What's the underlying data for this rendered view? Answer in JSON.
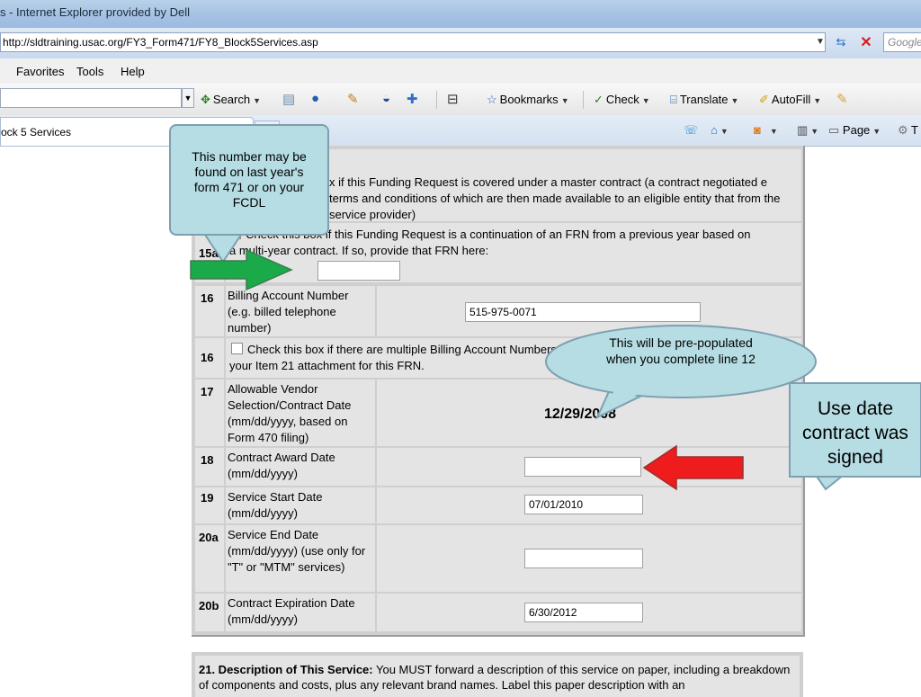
{
  "window": {
    "title": "s - Internet Explorer provided by Dell"
  },
  "address_bar": {
    "url": "http://sldtraining.usac.org/FY3_Form471/FY8_Block5Services.asp",
    "search_placeholder": "Google"
  },
  "menu": {
    "items": [
      "Favorites",
      "Tools",
      "Help"
    ]
  },
  "toolbar": {
    "search_label": "Search",
    "bookmarks_label": "Bookmarks",
    "check_label": "Check",
    "translate_label": "Translate",
    "autofill_label": "AutoFill"
  },
  "tab": {
    "title": "ock 5 Services"
  },
  "command_bar": {
    "page_label": "Page",
    "tools_label": "T"
  },
  "form": {
    "row15_text": "x if this Funding Request is covered under a master contract (a contract negotiated e terms and conditions of which are then made available to an eligible entity that from the service provider)",
    "row15a_num": "15a",
    "row15a_text_top": "Check this box if this Funding Request is a continuation of an FRN from a previous year based on",
    "row15a_text_bottom": "a multi-year contract. If so, provide that FRN here:",
    "row16_num": "16",
    "row16_label": "Billing Account Number (e.g. billed telephone number)",
    "row16_value": "515-975-0071",
    "row16b_num": "16",
    "row16b_text": "Check this box if there are multiple Billing Account Numbers. Attach a list of these additional numbers to your Item 21 attachment for this FRN.",
    "row17_num": "17",
    "row17_label": "Allowable Vendor Selection/Contract Date (mm/dd/yyyy, based on Form 470 filing)",
    "row17_value": "12/29/2008",
    "row18_num": "18",
    "row18_label": "Contract Award Date (mm/dd/yyyy)",
    "row18_value": "",
    "row19_num": "19",
    "row19_label": "Service Start Date (mm/dd/yyyy)",
    "row19_value": "07/01/2010",
    "row20a_num": "20a",
    "row20a_label": "Service End Date (mm/dd/yyyy) (use only for \"T\" or \"MTM\" services)",
    "row20a_value": "",
    "row20b_num": "20b",
    "row20b_label": "Contract Expiration Date (mm/dd/yyyy)",
    "row20b_value": "6/30/2012"
  },
  "section21": {
    "heading": "21.  Description of This Service:",
    "text": " You MUST forward a description of this service on paper, including a breakdown of components and costs, plus any relevant brand names. Label this paper description with an"
  },
  "callouts": {
    "frn_note": "This number may be found on last year's form 471 or on your FCDL",
    "prepopulated_note": "This will be pre-populated when you complete line 12",
    "date_note": "Use date contract was signed"
  },
  "colors": {
    "callout_fill": "#b5dde3",
    "green_arrow": "#1aaa4a",
    "red_arrow": "#ee1c1c"
  }
}
